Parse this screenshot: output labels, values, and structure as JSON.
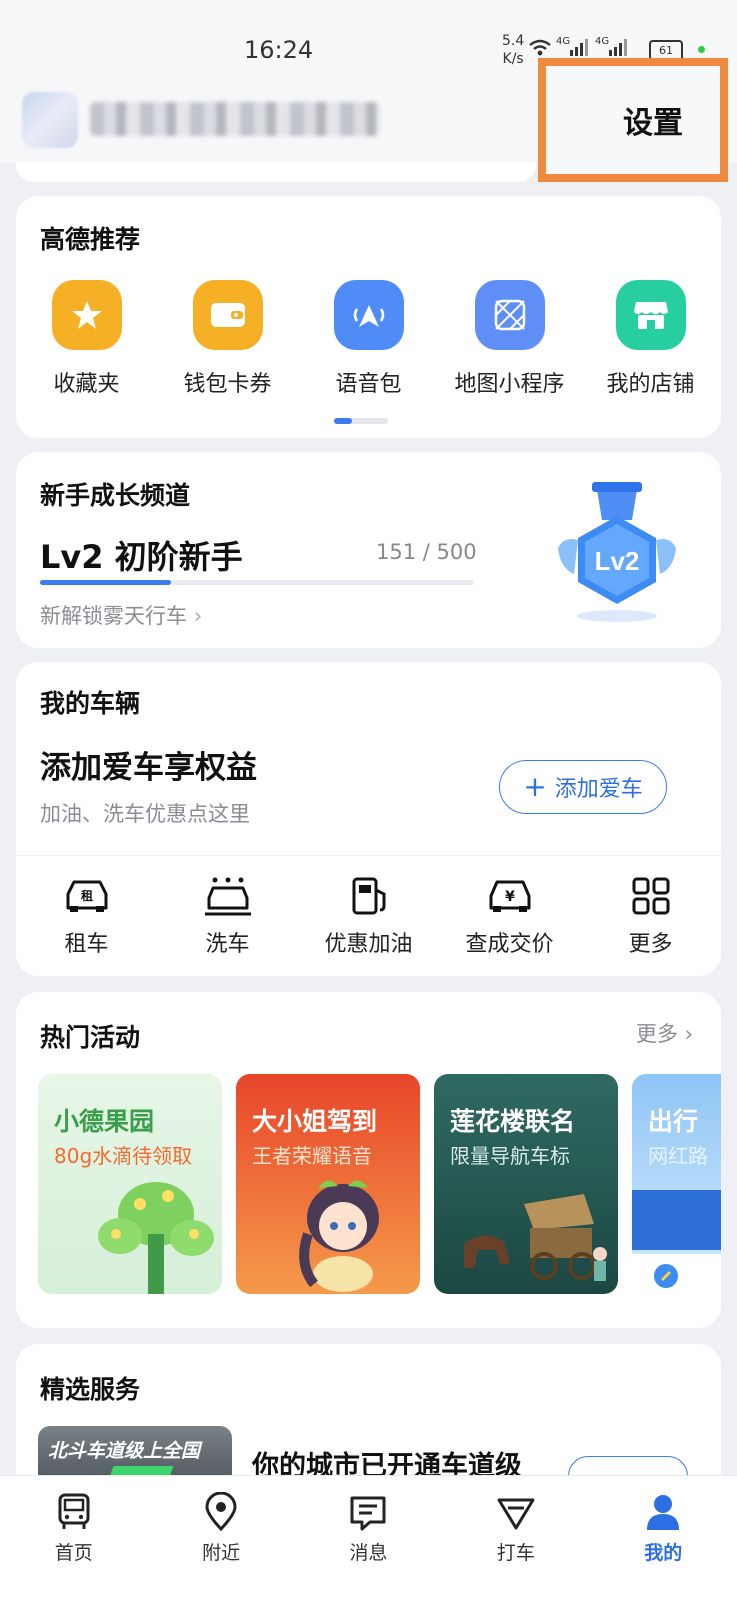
{
  "status_bar": {
    "time": "16:24",
    "net_speed_value": "5.4",
    "net_speed_unit": "K/s",
    "signal_1": "4G",
    "signal_2": "4G",
    "battery": "61"
  },
  "header": {
    "settings_label": "设置"
  },
  "recommend": {
    "title": "高德推荐",
    "items": [
      {
        "label": "收藏夹",
        "icon": "star-icon",
        "color": "#f5b025"
      },
      {
        "label": "钱包卡券",
        "icon": "wallet-icon",
        "color": "#f5b025"
      },
      {
        "label": "语音包",
        "icon": "voice-pack-icon",
        "color": "#4f8cf7"
      },
      {
        "label": "地图小程序",
        "icon": "map-miniapp-icon",
        "color": "#5f8ff6"
      },
      {
        "label": "我的店铺",
        "icon": "shop-icon",
        "color": "#27cfa0"
      }
    ],
    "page_indicator": {
      "pages": 2,
      "current": 1
    }
  },
  "growth": {
    "title": "新手成长频道",
    "level_text": "Lv2 初阶新手",
    "score_text": "151 / 500",
    "progress": 0.302,
    "unlock_text": "新解锁雾天行车",
    "badge_text": "Lv2"
  },
  "vehicle": {
    "title": "我的车辆",
    "headline": "添加爱车享权益",
    "subtitle": "加油、洗车优惠点这里",
    "add_button": "添加爱车",
    "services": [
      {
        "label": "租车",
        "icon": "car-rental-icon"
      },
      {
        "label": "洗车",
        "icon": "car-wash-icon"
      },
      {
        "label": "优惠加油",
        "icon": "fuel-pump-icon"
      },
      {
        "label": "查成交价",
        "icon": "car-price-icon"
      },
      {
        "label": "更多",
        "icon": "grid-more-icon"
      }
    ],
    "rental_glyph": "租",
    "price_glyph": "¥"
  },
  "activities": {
    "title": "热门活动",
    "more_label": "更多",
    "cards": [
      {
        "title": "小德果园",
        "subtitle": "80g水滴待领取",
        "accent": "#3b9e4c"
      },
      {
        "title": "大小姐驾到",
        "subtitle": "王者荣耀语音",
        "accent": "#ffffff"
      },
      {
        "title": "莲花楼联名",
        "subtitle": "限量导航车标",
        "accent": "#ffffff"
      },
      {
        "title": "出行",
        "subtitle": "网红路",
        "accent": "#ffffff"
      }
    ]
  },
  "featured": {
    "title": "精选服务",
    "banner_text": "北斗车道级上全国",
    "headline": "你的城市已开通车道级"
  },
  "tabbar": {
    "items": [
      {
        "label": "首页",
        "icon": "home-bus-icon",
        "active": false
      },
      {
        "label": "附近",
        "icon": "location-pin-icon",
        "active": false
      },
      {
        "label": "消息",
        "icon": "message-icon",
        "active": false
      },
      {
        "label": "打车",
        "icon": "taxi-icon",
        "active": false
      },
      {
        "label": "我的",
        "icon": "profile-icon",
        "active": true
      }
    ]
  }
}
